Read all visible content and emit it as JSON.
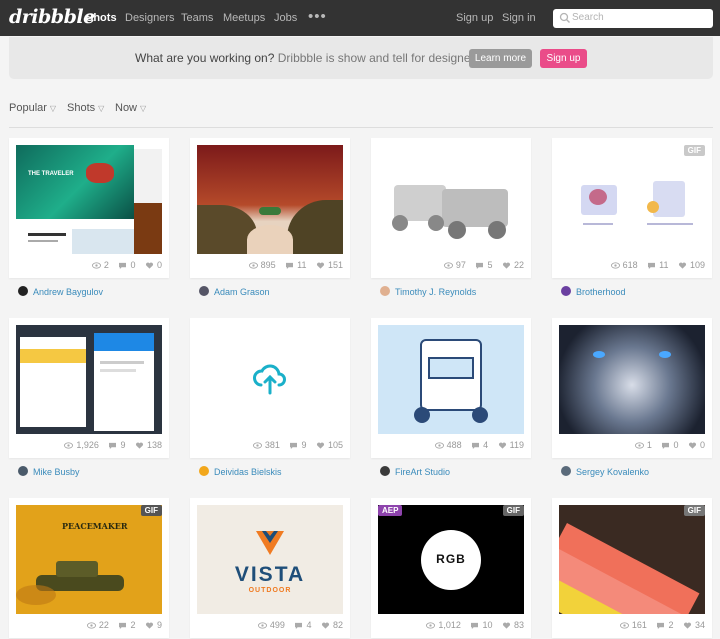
{
  "header": {
    "logo": "dribbble",
    "nav": [
      "Shots",
      "Designers",
      "Teams",
      "Meetups",
      "Jobs"
    ],
    "more": "•••",
    "signup": "Sign up",
    "signin": "Sign in",
    "search_placeholder": "Search"
  },
  "banner": {
    "question": "What are you working on?",
    "tagline": "Dribbble is show and tell for designers.",
    "learn_more": "Learn more",
    "sign_up": "Sign up"
  },
  "filters": {
    "popular": "Popular",
    "shots": "Shots",
    "now": "Now"
  },
  "colors": {
    "accent": "#ea4c89",
    "link": "#3a8bbb",
    "header": "#333333"
  },
  "shots": [
    {
      "views": "2",
      "comments": "0",
      "likes": "0",
      "author": "Andrew Baygulov",
      "thumb_text": "THE TRAVELER",
      "gif": "",
      "aep": ""
    },
    {
      "views": "895",
      "comments": "11",
      "likes": "151",
      "author": "Adam Grason",
      "thumb_text": "",
      "gif": "",
      "aep": ""
    },
    {
      "views": "97",
      "comments": "5",
      "likes": "22",
      "author": "Timothy J. Reynolds",
      "thumb_text": "",
      "gif": "",
      "aep": ""
    },
    {
      "views": "618",
      "comments": "11",
      "likes": "109",
      "author": "Brotherhood",
      "thumb_text": "",
      "gif": "GIF",
      "aep": ""
    },
    {
      "views": "1,926",
      "comments": "9",
      "likes": "138",
      "author": "Mike Busby",
      "thumb_text": "",
      "gif": "",
      "aep": ""
    },
    {
      "views": "381",
      "comments": "9",
      "likes": "105",
      "author": "Deividas Bielskis",
      "thumb_text": "",
      "gif": "",
      "aep": ""
    },
    {
      "views": "488",
      "comments": "4",
      "likes": "119",
      "author": "FireArt Studio",
      "thumb_text": "",
      "gif": "",
      "aep": ""
    },
    {
      "views": "1",
      "comments": "0",
      "likes": "0",
      "author": "Sergey Kovalenko",
      "thumb_text": "",
      "gif": "",
      "aep": ""
    },
    {
      "views": "22",
      "comments": "2",
      "likes": "9",
      "author": "",
      "thumb_text": "PEACEMAKER",
      "gif": "GIF",
      "aep": ""
    },
    {
      "views": "499",
      "comments": "4",
      "likes": "82",
      "author": "",
      "thumb_text": "VISTA",
      "thumb_sub": "OUTDOOR",
      "gif": "",
      "aep": ""
    },
    {
      "views": "1,012",
      "comments": "10",
      "likes": "83",
      "author": "",
      "thumb_text": "RGB",
      "gif": "GIF",
      "aep": "AEP"
    },
    {
      "views": "161",
      "comments": "2",
      "likes": "34",
      "author": "",
      "thumb_text": "",
      "gif": "GIF",
      "aep": ""
    }
  ]
}
